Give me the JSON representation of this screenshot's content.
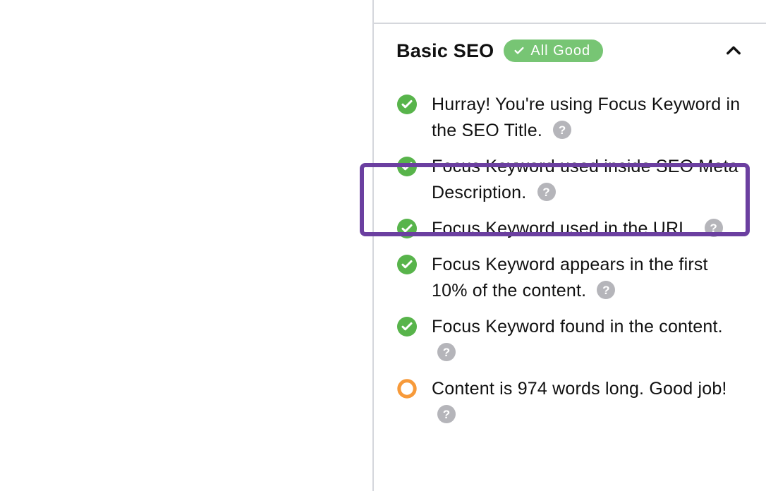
{
  "section": {
    "title": "Basic SEO",
    "badge_label": "All Good",
    "items": [
      {
        "text": "Hurray! You're using Focus Keyword in the SEO Title.",
        "status": "check"
      },
      {
        "text": "Focus Keyword used inside SEO Meta Description.",
        "status": "check"
      },
      {
        "text": "Focus Keyword used in the URL.",
        "status": "check"
      },
      {
        "text": "Focus Keyword appears in the first 10% of the content.",
        "status": "check"
      },
      {
        "text": "Focus Keyword found in the content.",
        "status": "check"
      },
      {
        "text": "Content is 974 words long. Good job!",
        "status": "ring"
      }
    ],
    "highlighted_index": 1
  }
}
